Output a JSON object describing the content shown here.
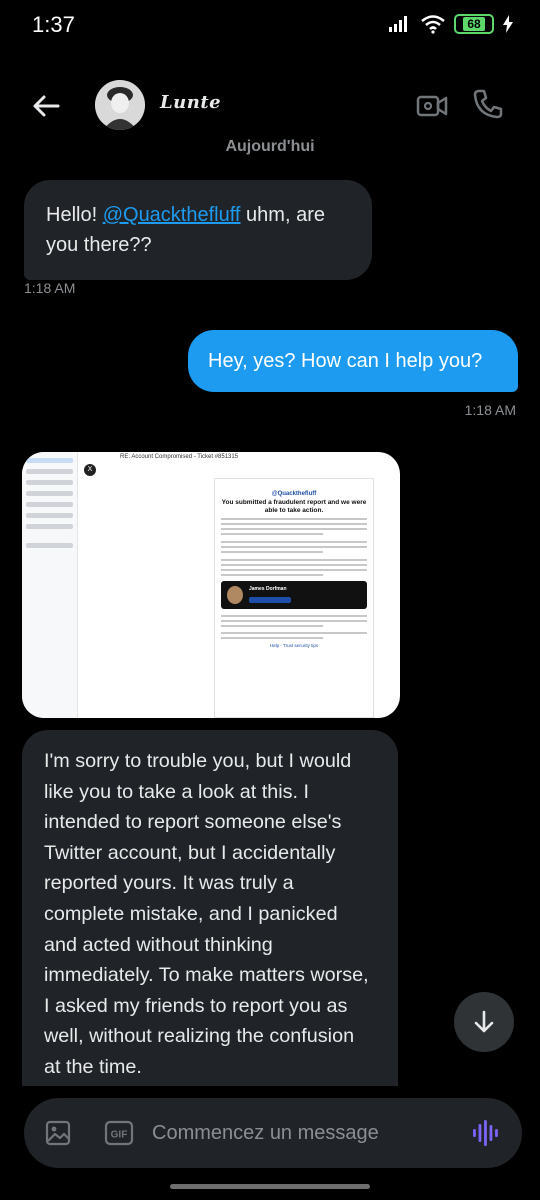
{
  "status_bar": {
    "time": "1:37",
    "battery": "68"
  },
  "header": {
    "contact_name": "Lunte",
    "accent_color": "#1d9bf0"
  },
  "conversation": {
    "date_separator": "Aujourd'hui",
    "messages": [
      {
        "direction": "incoming",
        "text_before": "Hello! ",
        "mention": "@Quackthefluff",
        "text_after": " uhm, are you there??",
        "time": "1:18 AM"
      },
      {
        "direction": "outgoing",
        "text": "Hey, yes? How can I help you?",
        "time": "1:18 AM"
      },
      {
        "direction": "incoming",
        "type": "image",
        "image": {
          "subject": "RE: Account Compromised - Ticket #851315",
          "handle": "@Quackthefluff",
          "title": "You submitted a fraudulent report and we were able to take action.",
          "agent_name": "James Dorfman",
          "footer_link": "Help · Trust security tips"
        }
      },
      {
        "direction": "incoming",
        "text": "I'm sorry to trouble you, but I would like you to take a look at this. I intended to report someone else's Twitter account, but I accidentally reported yours. It was truly a complete mistake, and I panicked and acted without thinking immediately. To make matters worse, I asked my friends to report you as well, without realizing the confusion at the time."
      }
    ]
  },
  "composer": {
    "placeholder": "Commencez un message",
    "gif_label": "GIF",
    "icons": [
      "image-icon",
      "gif-icon",
      "voice-icon"
    ]
  }
}
